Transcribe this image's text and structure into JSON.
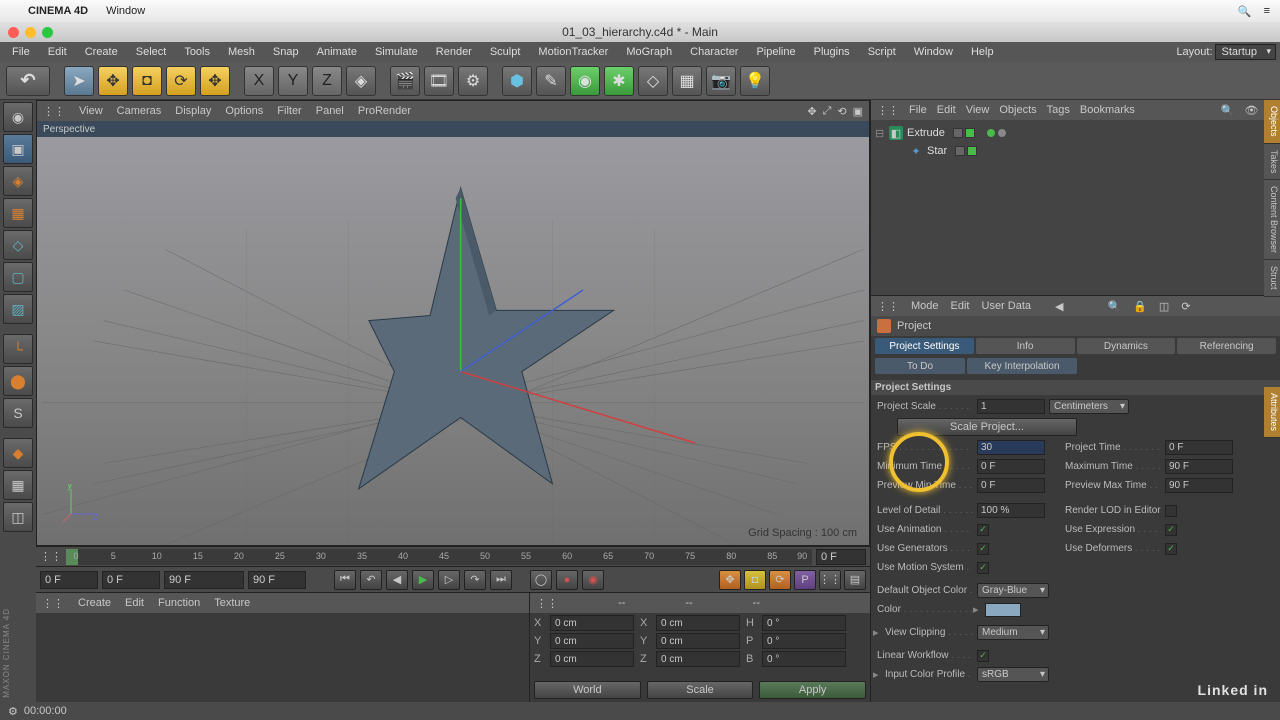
{
  "mac_menu": {
    "apple": "",
    "app": "CINEMA 4D",
    "items": [
      "Window"
    ],
    "right_icons": [
      "🔍",
      "≡"
    ]
  },
  "titlebar": {
    "title": "01_03_hierarchy.c4d * - Main"
  },
  "main_menu": {
    "items": [
      "File",
      "Edit",
      "Create",
      "Select",
      "Tools",
      "Mesh",
      "Snap",
      "Animate",
      "Simulate",
      "Render",
      "Sculpt",
      "MotionTracker",
      "MoGraph",
      "Character",
      "Pipeline",
      "Plugins",
      "Script",
      "Window",
      "Help"
    ],
    "layout_label": "Layout:",
    "layout_value": "Startup"
  },
  "viewport_menu": {
    "items": [
      "View",
      "Cameras",
      "Display",
      "Options",
      "Filter",
      "Panel",
      "ProRender"
    ],
    "title": "Perspective",
    "grid_label": "Grid Spacing : 100 cm"
  },
  "timeline": {
    "ticks": [
      0,
      5,
      10,
      15,
      20,
      25,
      30,
      35,
      40,
      45,
      50,
      55,
      60,
      65,
      70,
      75,
      80,
      85,
      90
    ],
    "cur": "0 F"
  },
  "playback": {
    "start": "0 F",
    "range_start": "0 F",
    "range_end": "90 F",
    "end": "90 F"
  },
  "material_menu": {
    "items": [
      "Create",
      "Edit",
      "Function",
      "Texture"
    ]
  },
  "coords": {
    "heads": [
      "--",
      "--",
      "--"
    ],
    "rows": [
      {
        "l": "X",
        "v": "0 cm",
        "l2": "X",
        "v2": "0 cm",
        "l3": "H",
        "v3": "0 °"
      },
      {
        "l": "Y",
        "v": "0 cm",
        "l2": "Y",
        "v2": "0 cm",
        "l3": "P",
        "v3": "0 °"
      },
      {
        "l": "Z",
        "v": "0 cm",
        "l2": "Z",
        "v2": "0 cm",
        "l3": "B",
        "v3": "0 °"
      }
    ],
    "world": "World",
    "scale": "Scale",
    "apply": "Apply"
  },
  "obj_manager": {
    "menu": [
      "File",
      "Edit",
      "View",
      "Objects",
      "Tags",
      "Bookmarks"
    ],
    "items": [
      {
        "name": "Extrude",
        "icon": "extrude",
        "depth": 0,
        "children": true
      },
      {
        "name": "Star",
        "icon": "star",
        "depth": 1,
        "children": false
      }
    ]
  },
  "attr_manager": {
    "menu": [
      "Mode",
      "Edit",
      "User Data"
    ],
    "head": "Project",
    "tabs1": [
      "Project Settings",
      "Info",
      "Dynamics",
      "Referencing"
    ],
    "tabs2": [
      "To Do",
      "Key Interpolation"
    ],
    "section": "Project Settings",
    "project_scale_lbl": "Project Scale",
    "project_scale_val": "1",
    "project_scale_unit": "Centimeters",
    "scale_project_btn": "Scale Project...",
    "fps_lbl": "FPS",
    "fps_val": "30",
    "project_time_lbl": "Project Time",
    "project_time_val": "0 F",
    "min_time_lbl": "Minimum Time",
    "min_time_val": "0 F",
    "max_time_lbl": "Maximum Time",
    "max_time_val": "90 F",
    "preview_min_lbl": "Preview Min Time",
    "preview_min_val": "0 F",
    "preview_max_lbl": "Preview Max Time",
    "preview_max_val": "90 F",
    "lod_lbl": "Level of Detail",
    "lod_val": "100 %",
    "render_lod_lbl": "Render LOD in Editor",
    "use_anim_lbl": "Use Animation",
    "use_expr_lbl": "Use Expression",
    "use_gen_lbl": "Use Generators",
    "use_def_lbl": "Use Deformers",
    "use_motion_lbl": "Use Motion System",
    "def_color_lbl": "Default Object Color",
    "def_color_val": "Gray-Blue",
    "color_lbl": "Color",
    "view_clip_lbl": "View Clipping",
    "view_clip_val": "Medium",
    "linear_wf_lbl": "Linear Workflow",
    "input_cp_lbl": "Input Color Profile",
    "input_cp_val": "sRGB"
  },
  "side_tabs": [
    "Objects",
    "Takes",
    "Content Browser",
    "Struct",
    "Attributes"
  ],
  "status": {
    "time": "00:00:00"
  },
  "watermark": "Linked in",
  "maxon": "MAXON CINEMA 4D"
}
